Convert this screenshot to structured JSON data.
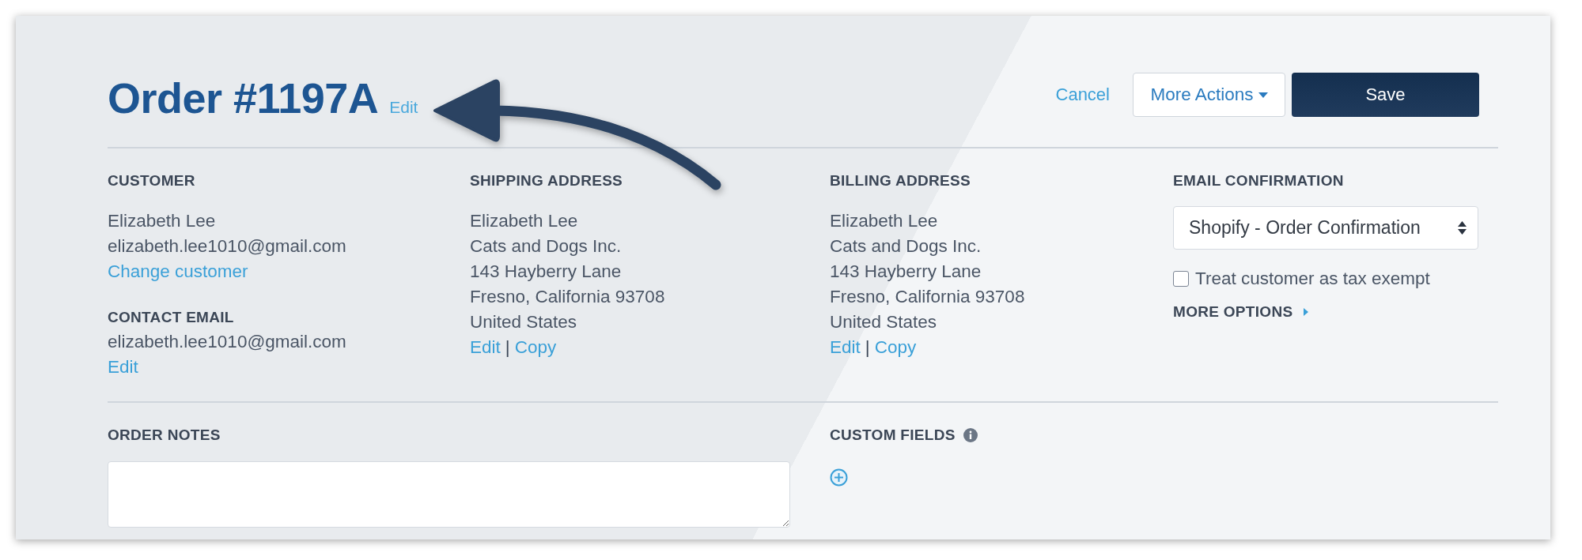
{
  "header": {
    "title": "Order #1197A",
    "title_link": "Edit",
    "actions": [
      {
        "kind": "cancel",
        "label": "Cancel"
      },
      {
        "kind": "menu",
        "label": "More Actions"
      },
      {
        "kind": "save",
        "label": "Save"
      }
    ]
  },
  "columns": [
    {
      "kind": "info",
      "groups": [
        {
          "heading": "CUSTOMER",
          "lines": [
            "Elizabeth Lee",
            "elizabeth.lee1010@gmail.com"
          ],
          "links": [
            "Change customer"
          ]
        },
        {
          "heading": "CONTACT EMAIL",
          "lines": [
            "elizabeth.lee1010@gmail.com"
          ],
          "links": [
            "Edit"
          ]
        }
      ]
    },
    {
      "kind": "info",
      "groups": [
        {
          "heading": "SHIPPING ADDRESS",
          "lines": [
            "Elizabeth Lee",
            "Cats and Dogs Inc.",
            "143 Hayberry Lane",
            "Fresno, California 93708",
            "United States"
          ],
          "links": [
            "Edit",
            "Copy"
          ],
          "separator": "|"
        }
      ]
    },
    {
      "kind": "info",
      "groups": [
        {
          "heading": "BILLING ADDRESS",
          "lines": [
            "Elizabeth Lee",
            "Cats and Dogs Inc.",
            "143 Hayberry Lane",
            "Fresno, California 93708",
            "United States"
          ],
          "links": [
            "Edit",
            "Copy"
          ],
          "separator": "|"
        }
      ]
    },
    {
      "kind": "email",
      "heading": "EMAIL CONFIRMATION",
      "select": {
        "value": "Shopify - Order Confirmation"
      },
      "checkbox": {
        "label": "Treat customer as tax exempt",
        "checked": false
      },
      "more_options": "MORE OPTIONS"
    }
  ],
  "bottom_sections": [
    {
      "kind": "notes",
      "heading": "ORDER NOTES"
    },
    {
      "kind": "custom_fields",
      "heading": "CUSTOM FIELDS"
    }
  ]
}
